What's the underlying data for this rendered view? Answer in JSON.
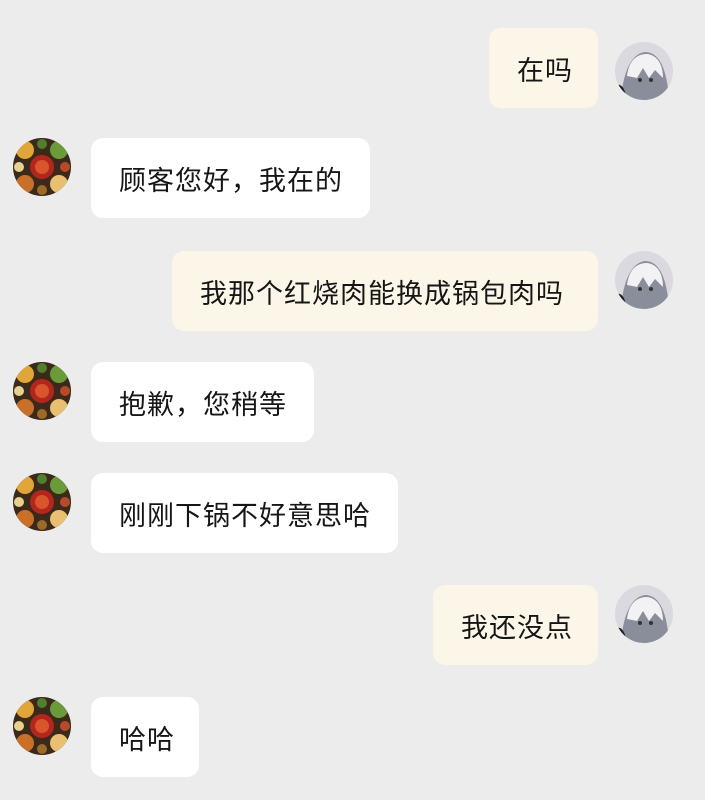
{
  "messages": [
    {
      "side": "out",
      "text": "在吗",
      "avatar_icon": "user-avatar-anime-icon"
    },
    {
      "side": "in",
      "text": "顾客您好，我在的",
      "avatar_icon": "shop-avatar-food-icon"
    },
    {
      "side": "out",
      "text": "我那个红烧肉能换成锅包肉吗",
      "avatar_icon": "user-avatar-anime-icon"
    },
    {
      "side": "in",
      "text": "抱歉，您稍等",
      "avatar_icon": "shop-avatar-food-icon"
    },
    {
      "side": "in",
      "text": "刚刚下锅不好意思哈",
      "avatar_icon": "shop-avatar-food-icon"
    },
    {
      "side": "out",
      "text": "我还没点",
      "avatar_icon": "user-avatar-anime-icon"
    },
    {
      "side": "in",
      "text": "哈哈",
      "avatar_icon": "shop-avatar-food-icon"
    }
  ],
  "colors": {
    "background": "#ececec",
    "incoming_bubble": "#ffffff",
    "outgoing_bubble": "#fbf6e8",
    "text": "#161616"
  }
}
